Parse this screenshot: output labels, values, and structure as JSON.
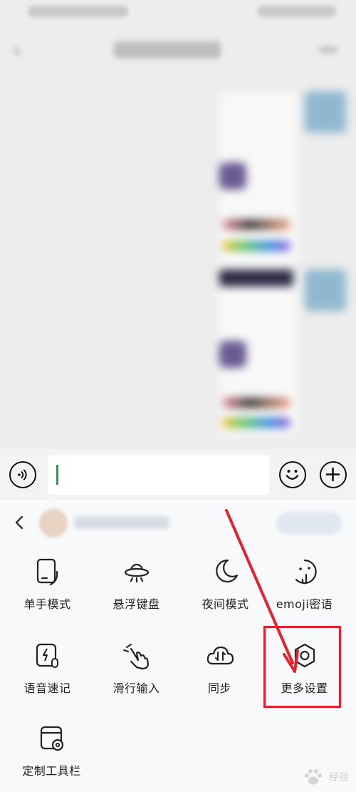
{
  "input_bar": {
    "message_value": ""
  },
  "toolbar_panel": {
    "tools": [
      {
        "id": "one-hand",
        "label": "单手模式"
      },
      {
        "id": "floating-keyboard",
        "label": "悬浮键盘"
      },
      {
        "id": "night-mode",
        "label": "夜间模式"
      },
      {
        "id": "emoji-code",
        "label": "emoji密语"
      },
      {
        "id": "voice-memo",
        "label": "语音速记"
      },
      {
        "id": "swipe-input",
        "label": "滑行输入"
      },
      {
        "id": "sync",
        "label": "同步"
      },
      {
        "id": "more-settings",
        "label": "更多设置"
      },
      {
        "id": "custom-toolbar",
        "label": "定制工具栏"
      }
    ]
  },
  "annotation": {
    "highlight_color": "#e2232f",
    "highlight_target": "more-settings"
  },
  "colors": {
    "caret": "#1aa34a",
    "panel_bg": "#f7f9fb",
    "icon_stroke": "#222222"
  },
  "watermark": {
    "text": "经验"
  }
}
